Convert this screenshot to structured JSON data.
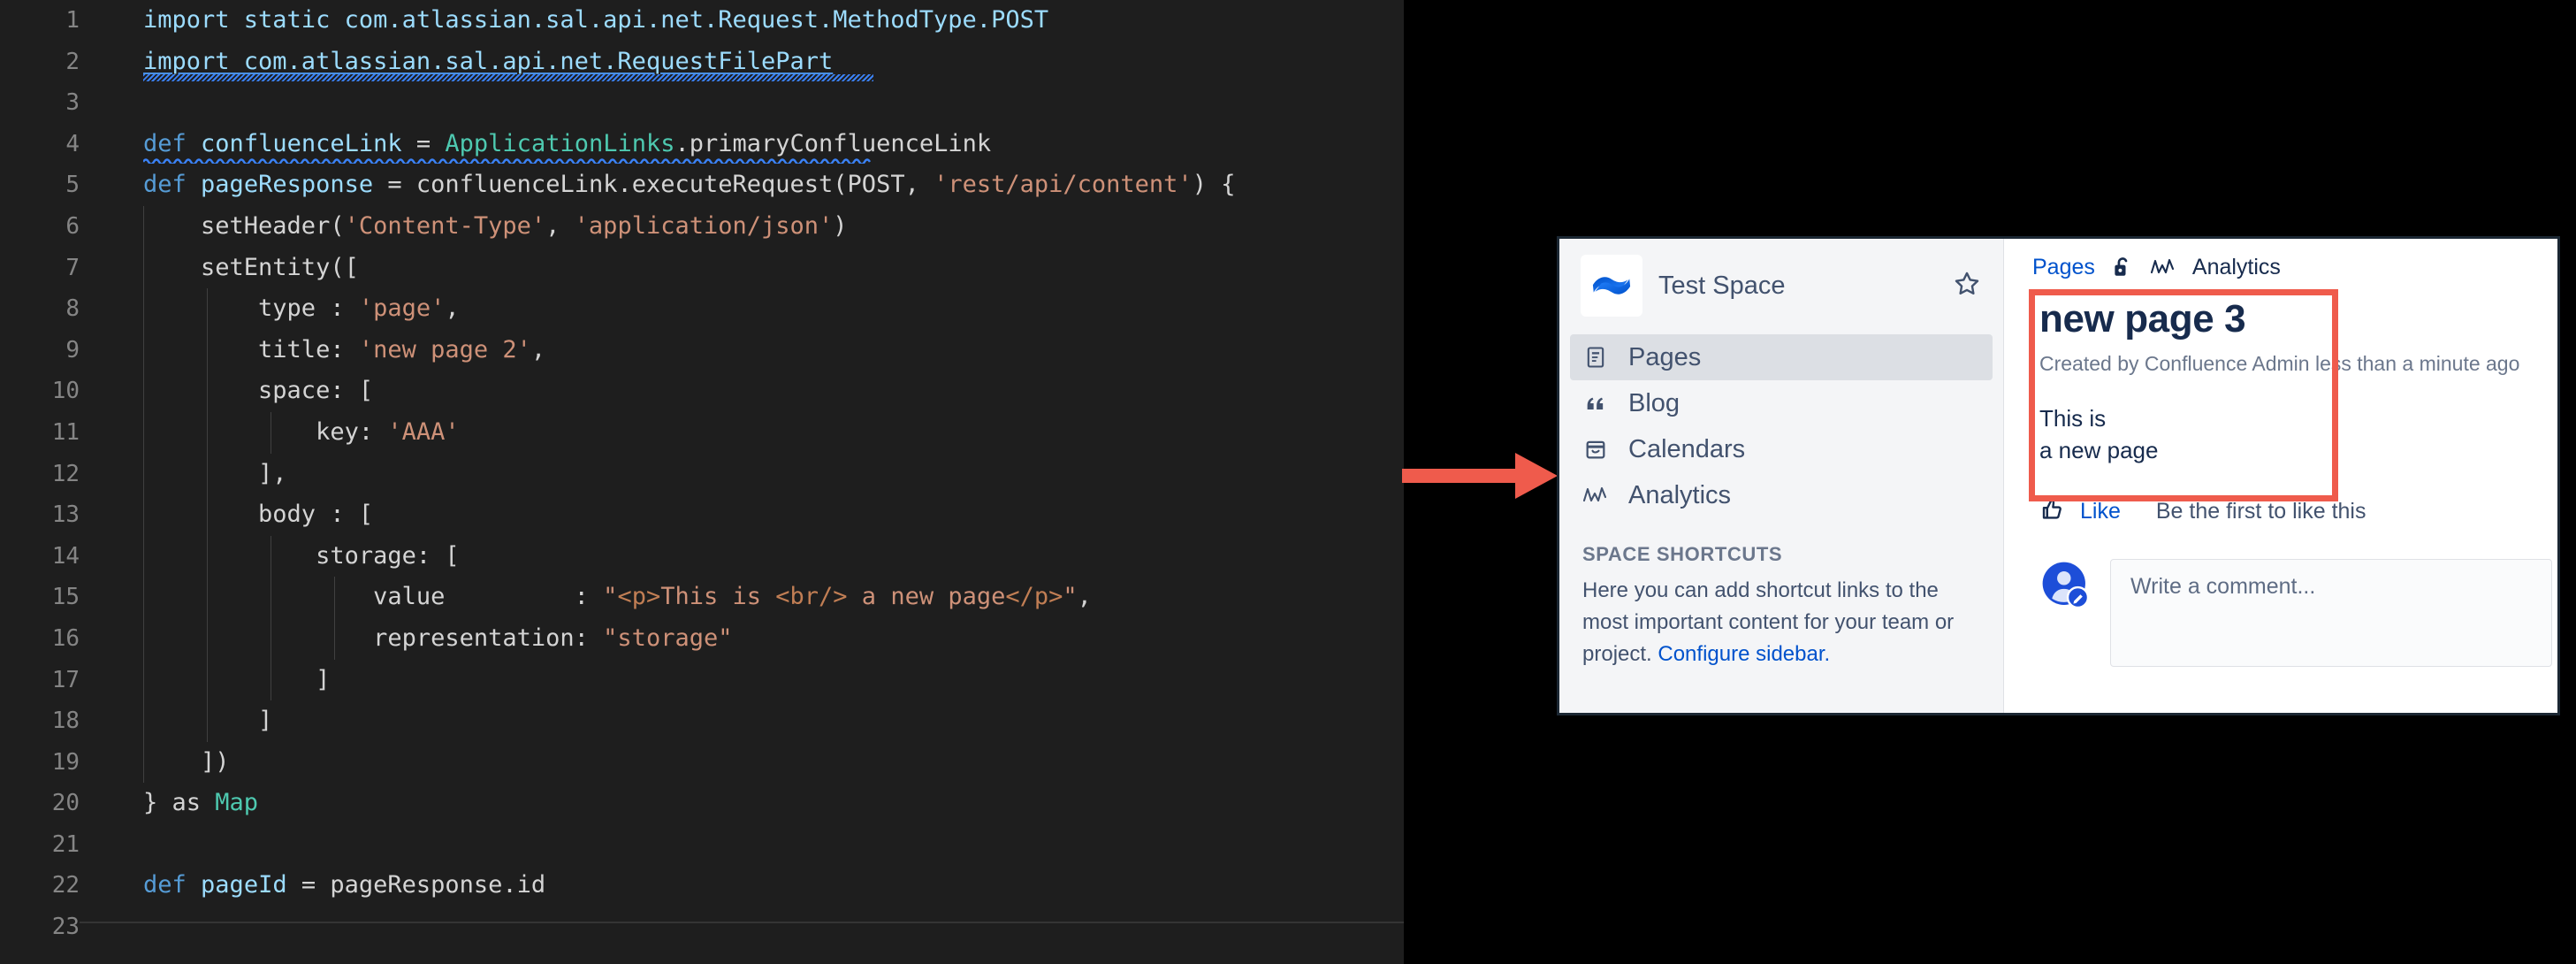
{
  "editor": {
    "language": "groovy",
    "theme_bg": "#1e1e1e",
    "lines": [
      {
        "n": "1",
        "text": "import static com.atlassian.sal.api.net.Request.MethodType.POST"
      },
      {
        "n": "2",
        "text": "import com.atlassian.sal.api.net.RequestFilePart"
      },
      {
        "n": "3",
        "text": ""
      },
      {
        "n": "4",
        "text": "def confluenceLink = ApplicationLinks.primaryConfluenceLink"
      },
      {
        "n": "5",
        "text": "def pageResponse = confluenceLink.executeRequest(POST, 'rest/api/content') {"
      },
      {
        "n": "6",
        "text": "    setHeader('Content-Type', 'application/json')"
      },
      {
        "n": "7",
        "text": "    setEntity(["
      },
      {
        "n": "8",
        "text": "        type : 'page',"
      },
      {
        "n": "9",
        "text": "        title: 'new page 2',"
      },
      {
        "n": "10",
        "text": "        space: ["
      },
      {
        "n": "11",
        "text": "            key: 'AAA'"
      },
      {
        "n": "12",
        "text": "        ],"
      },
      {
        "n": "13",
        "text": "        body : ["
      },
      {
        "n": "14",
        "text": "            storage: ["
      },
      {
        "n": "15",
        "text": "                value         : \"<p>This is <br/> a new page</p>\","
      },
      {
        "n": "16",
        "text": "                representation: \"storage\""
      },
      {
        "n": "17",
        "text": "            ]"
      },
      {
        "n": "18",
        "text": "        ]"
      },
      {
        "n": "19",
        "text": "    ])"
      },
      {
        "n": "20",
        "text": "} as Map"
      },
      {
        "n": "21",
        "text": ""
      },
      {
        "n": "22",
        "text": "def pageId = pageResponse.id"
      },
      {
        "n": "23",
        "text": ""
      }
    ],
    "error_line": "2",
    "error_hint": "unresolved-import"
  },
  "annotation": {
    "arrow_color": "#ef5b4c",
    "arrow_direction": "right",
    "highlight_color": "#ef5b4c"
  },
  "confluence": {
    "sidebar": {
      "space_name": "Test Space",
      "space_logo_icon": "confluence-space-logo",
      "star_icon": "star-outline-icon",
      "items": [
        {
          "label": "Pages",
          "icon": "page-icon",
          "active": true
        },
        {
          "label": "Blog",
          "icon": "quote-icon",
          "active": false
        },
        {
          "label": "Calendars",
          "icon": "calendar-icon",
          "active": false
        },
        {
          "label": "Analytics",
          "icon": "analytics-icon",
          "active": false
        }
      ],
      "shortcuts_heading": "SPACE SHORTCUTS",
      "shortcuts_text": "Here you can add shortcut links to the most important content for your team or project. ",
      "shortcuts_link": "Configure sidebar."
    },
    "main": {
      "breadcrumb_pages": "Pages",
      "breadcrumb_lock_icon": "unlocked-padlock-icon",
      "breadcrumb_analytics_icon": "analytics-icon",
      "breadcrumb_analytics": "Analytics",
      "page_title": "new page 3",
      "page_meta": "Created by Confluence Admin less than a minute ago",
      "body_line_1": "This is",
      "body_line_2": "a new page",
      "like_icon": "thumbs-up-icon",
      "like_label": "Like",
      "like_note": "Be the first to like this",
      "avatar_icon": "user-avatar-edit-icon",
      "comment_placeholder": "Write a comment..."
    }
  }
}
